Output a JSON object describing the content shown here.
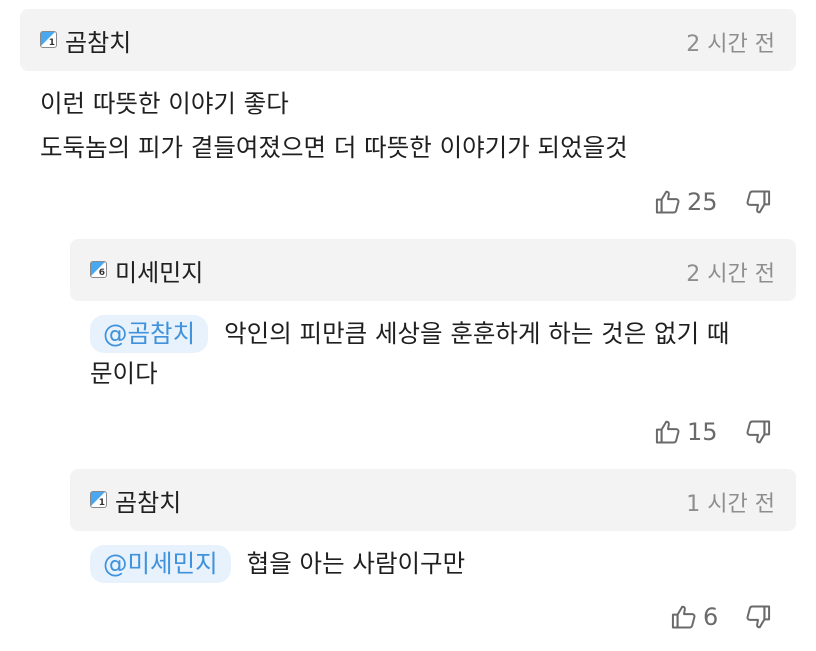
{
  "comments": [
    {
      "level_badge": "1",
      "username": "곰참치",
      "time": "2 시간 전",
      "text_lines": [
        "이런 따뜻한 이야기 좋다",
        "도둑놈의 피가 곁들여졌으면 더 따뜻한 이야기가 되었을것"
      ],
      "likes": "25"
    }
  ],
  "replies": [
    {
      "level_badge": "6",
      "username": "미세민지",
      "time": "2 시간 전",
      "mention": "@곰참치",
      "text_line1": "악인의 피만큼 세상을 훈훈하게 하는 것은 없기 때",
      "text_line2": "문이다",
      "likes": "15"
    },
    {
      "level_badge": "1",
      "username": "곰참치",
      "time": "1 시간 전",
      "mention": "@미세민지",
      "text_line1": "협을 아는 사람이구만",
      "likes": "6"
    }
  ],
  "colors": {
    "header_bg": "#f3f3f3",
    "mention_bg": "#e8f2fc",
    "mention_text": "#3f92db",
    "badge_blue": "#4aa8f0",
    "muted": "#8e8e8e"
  },
  "icons": {
    "like": "thumbs-up-outline-icon",
    "dislike": "thumbs-down-outline-icon",
    "level": "level-badge-icon"
  }
}
